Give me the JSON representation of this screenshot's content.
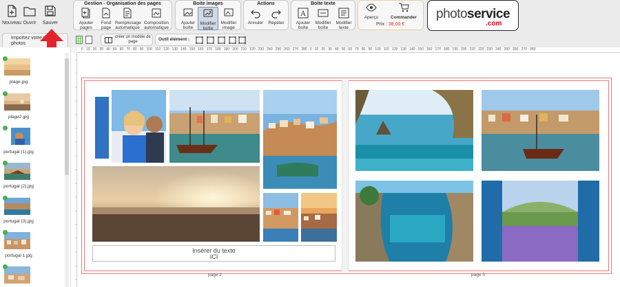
{
  "file": {
    "new_label": "Nouveau",
    "open_label": "Ouvrir",
    "save_label": "Sauver"
  },
  "groups": {
    "gestion": {
      "title": "Gestion - Organisation des pages",
      "buttons": [
        "Ajouter pages",
        "Fond page",
        "Remplissage automatique",
        "Composition automatique"
      ]
    },
    "boite_images": {
      "title": "Boite images",
      "buttons": [
        "Ajouter boîte",
        "Modifier boîte",
        "Modifier image"
      ]
    },
    "actions": {
      "title": "Actions",
      "buttons": [
        "Annuler",
        "Répéter"
      ]
    },
    "boite_texte": {
      "title": "Boite texte",
      "buttons": [
        "Ajouter boîte",
        "Modifier boîte",
        "Modifier texte"
      ]
    },
    "order": {
      "preview_label": "Aperçu",
      "order_label": "Commander",
      "price_label": "Prix :",
      "price_value": "38,00 €"
    }
  },
  "logo": {
    "text_a": "photo",
    "text_b": "service",
    "text_com": ".com"
  },
  "row2": {
    "import_label": "Importez votre dossier photos",
    "create_model_label": "créer un modèle de page",
    "tool_label": "Outil élément :"
  },
  "sidebar": {
    "items": [
      {
        "label": "plage.jpg"
      },
      {
        "label": "plage2.jpg"
      },
      {
        "label": "portugal (1).jpg"
      },
      {
        "label": "portugal (2).jpg"
      },
      {
        "label": "portugal (3).jpg"
      },
      {
        "label": "portugal 1.jpg"
      },
      {
        "label": ""
      }
    ]
  },
  "ruler": {
    "ticks": "0 . 10 . 20 . 30 . 40 . 50 . 60 . 70 . 80 . 90 . 100 . 110 . 120 . 130 . 140 . 150 . 160 . 170 . 180 . 190 . 200 . 210 . 220 . 230 . 240 . 250 . 260 . 270 . 280 . 0 . 10 . 20 . 30 . 40 . 50 . 60 . 70 . 80 . 90 . 100 . 110 . 120 . 130 . 140 . 150 . 160 . 170 . 180 . 190 . 200 . 210 . 220 . 230 . 240 . 250 . 260 . 270 . 280"
  },
  "canvas": {
    "text_placeholder_line1": "Insérer du texte",
    "text_placeholder_line2": "ICI",
    "page_left_label": "page 2",
    "page_right_label": "page 3"
  }
}
